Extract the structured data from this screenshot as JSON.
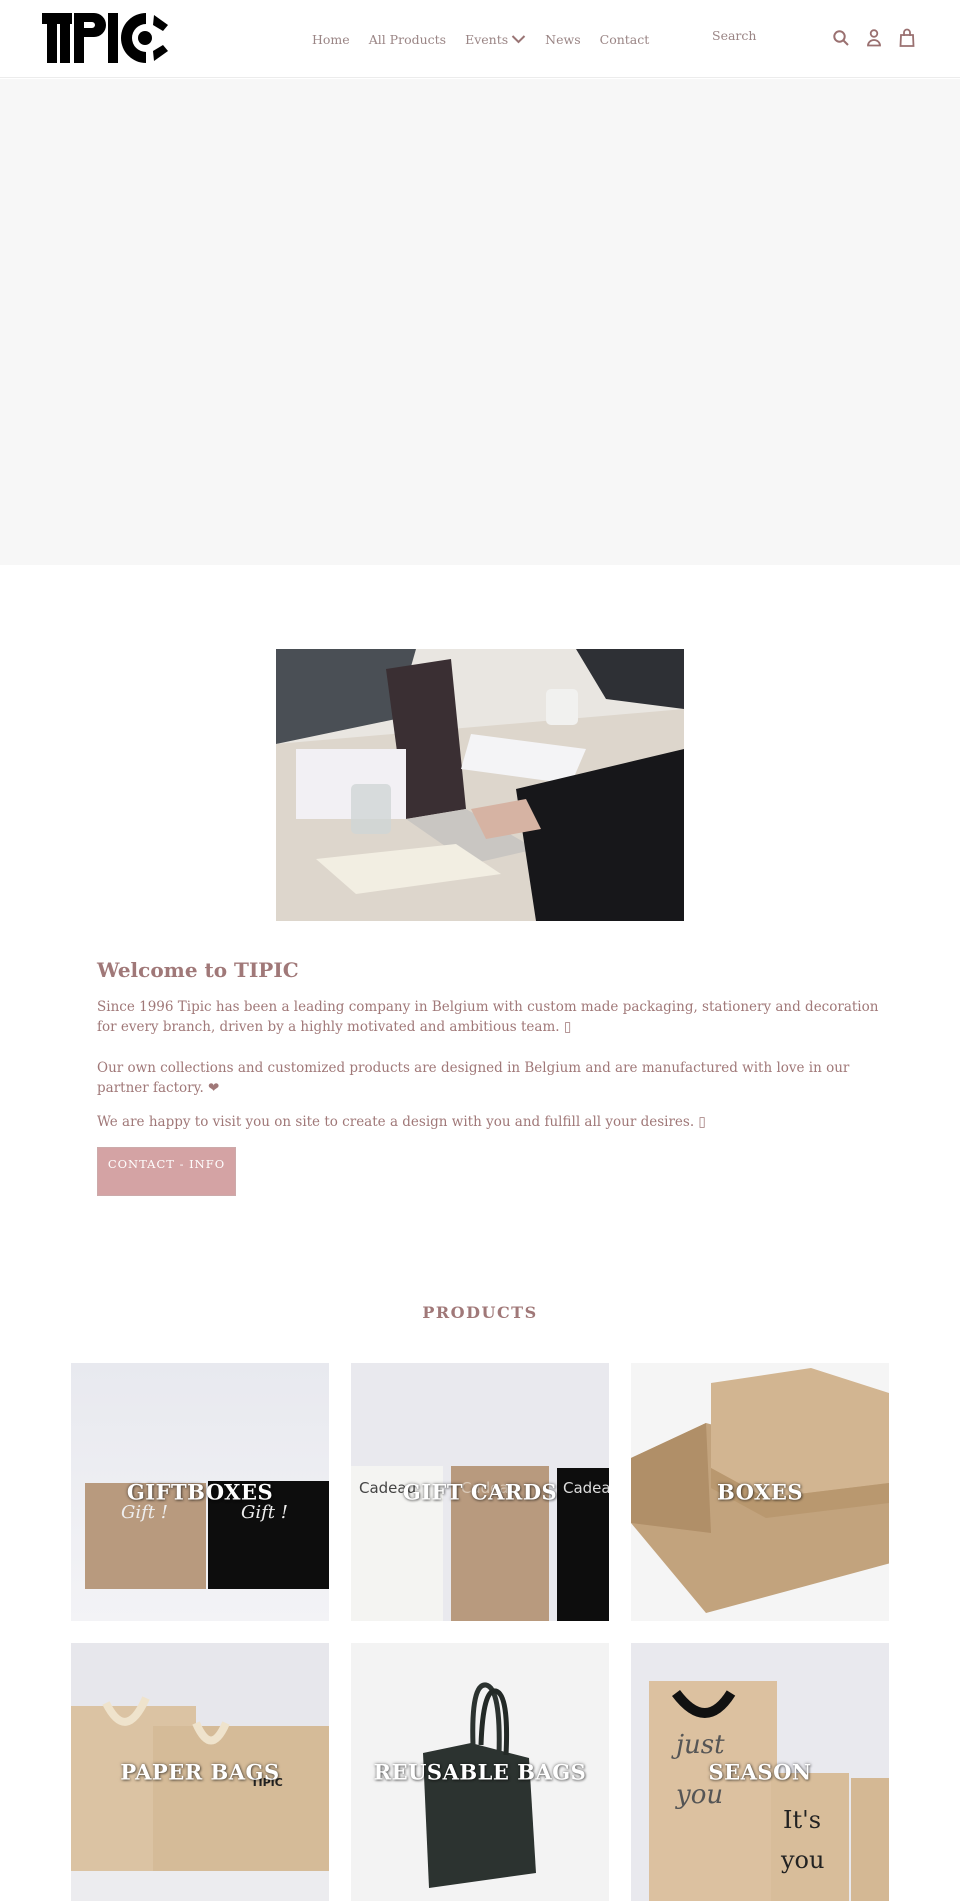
{
  "header": {
    "logo_text": "TIPIC",
    "nav": [
      {
        "label": "Home"
      },
      {
        "label": "All Products"
      },
      {
        "label": "Events",
        "has_dropdown": true
      },
      {
        "label": "News"
      },
      {
        "label": "Contact"
      }
    ],
    "search_placeholder": "Search",
    "icons": [
      "search-icon",
      "account-icon",
      "cart-icon"
    ]
  },
  "about": {
    "image_alt": "Team working at a table with a laptop",
    "title": "Welcome to TIPIC",
    "paragraphs": [
      "Since 1996 Tipic has been a leading company in Belgium with custom made packaging, stationery and decoration for every branch, driven by a highly motivated and ambitious team. ▯",
      "Our own collections and customized products are designed in Belgium and are manufactured with love in our partner factory. ❤",
      "We are happy to visit you on site to create a design with you and fulfill all your desires. ▯"
    ],
    "button_label": "CONTACT - INFO"
  },
  "products": {
    "title": "PRODUCTS",
    "items": [
      {
        "label": "GIFTBOXES"
      },
      {
        "label": "GIFT CARDS"
      },
      {
        "label": "BOXES"
      },
      {
        "label": "PAPER BAGS"
      },
      {
        "label": "REUSABLE BAGS"
      },
      {
        "label": "SEASON"
      }
    ]
  },
  "colors": {
    "accent": "#a07878",
    "button_bg": "#d4a3a4",
    "hero_bg": "#f7f7f7"
  }
}
